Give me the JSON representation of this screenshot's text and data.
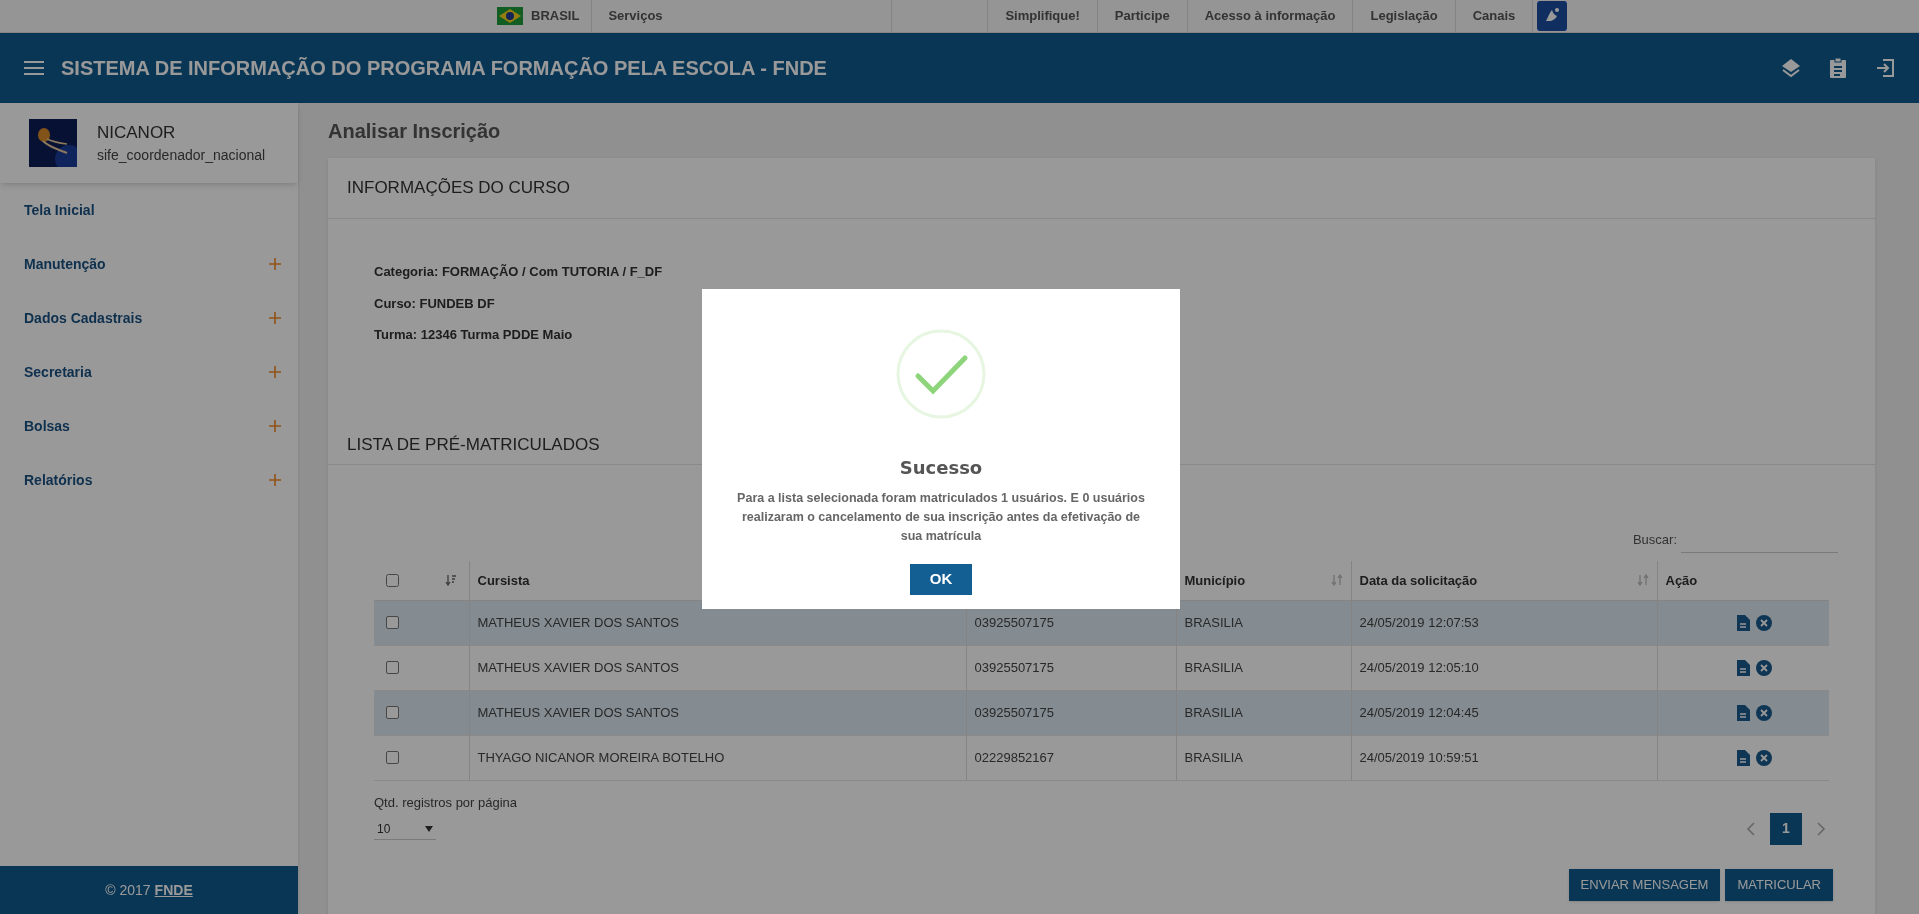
{
  "gov_bar": {
    "country": "BRASIL",
    "links": [
      "Serviços"
    ],
    "right_links": [
      "Simplifique!",
      "Participe",
      "Acesso à informação",
      "Legislação",
      "Canais"
    ]
  },
  "header": {
    "title": "SISTEMA DE INFORMAÇÃO DO PROGRAMA FORMAÇÃO PELA ESCOLA - FNDE"
  },
  "sidebar": {
    "user": {
      "name": "NICANOR",
      "role": "sife_coordenador_nacional"
    },
    "items": [
      {
        "label": "Tela Inicial",
        "expandable": false
      },
      {
        "label": "Manutenção",
        "expandable": true
      },
      {
        "label": "Dados Cadastrais",
        "expandable": true
      },
      {
        "label": "Secretaria",
        "expandable": true
      },
      {
        "label": "Bolsas",
        "expandable": true
      },
      {
        "label": "Relatórios",
        "expandable": true
      }
    ],
    "footer": {
      "text": "© 2017",
      "link": "FNDE"
    }
  },
  "page_title": "Analisar Inscrição",
  "course": {
    "heading": "INFORMAÇÕES DO CURSO",
    "lines": [
      "Categoria: FORMAÇÃO / Com TUTORIA / F_DF",
      "Curso: FUNDEB DF",
      "Turma: 12346 Turma PDDE Maio"
    ]
  },
  "list": {
    "heading": "LISTA DE PRÉ-MATRICULADOS",
    "search_label": "Buscar:",
    "table": {
      "select_all_checked": false,
      "columns": [
        "Cursista",
        "Município",
        "Data da solicitação",
        "Ação"
      ],
      "rows": [
        {
          "checked": false,
          "name": "MATHEUS XAVIER DOS SANTOS",
          "cpf": "03925507175",
          "city": "BRASILIA",
          "date": "24/05/2019 12:07:53"
        },
        {
          "checked": false,
          "name": "MATHEUS XAVIER DOS SANTOS",
          "cpf": "03925507175",
          "city": "BRASILIA",
          "date": "24/05/2019 12:05:10"
        },
        {
          "checked": false,
          "name": "MATHEUS XAVIER DOS SANTOS",
          "cpf": "03925507175",
          "city": "BRASILIA",
          "date": "24/05/2019 12:04:45"
        },
        {
          "checked": false,
          "name": "THYAGO NICANOR MOREIRA BOTELHO",
          "cpf": "02229852167",
          "city": "BRASILIA",
          "date": "24/05/2019 10:59:51"
        }
      ]
    },
    "page_size_label": "Qtd. registros por página",
    "page_size": "10",
    "pages": [
      {
        "label": "1",
        "selected": true
      }
    ],
    "buttons": [
      "ENVIAR MENSAGEM",
      "MATRICULAR"
    ]
  },
  "modal": {
    "title": "Sucesso",
    "message": "Para a lista selecionada foram matriculados 1 usuários. E 0 usuários realizaram o cancelamento de sua inscrição antes da efetivação de sua matrícula",
    "button": "OK"
  }
}
